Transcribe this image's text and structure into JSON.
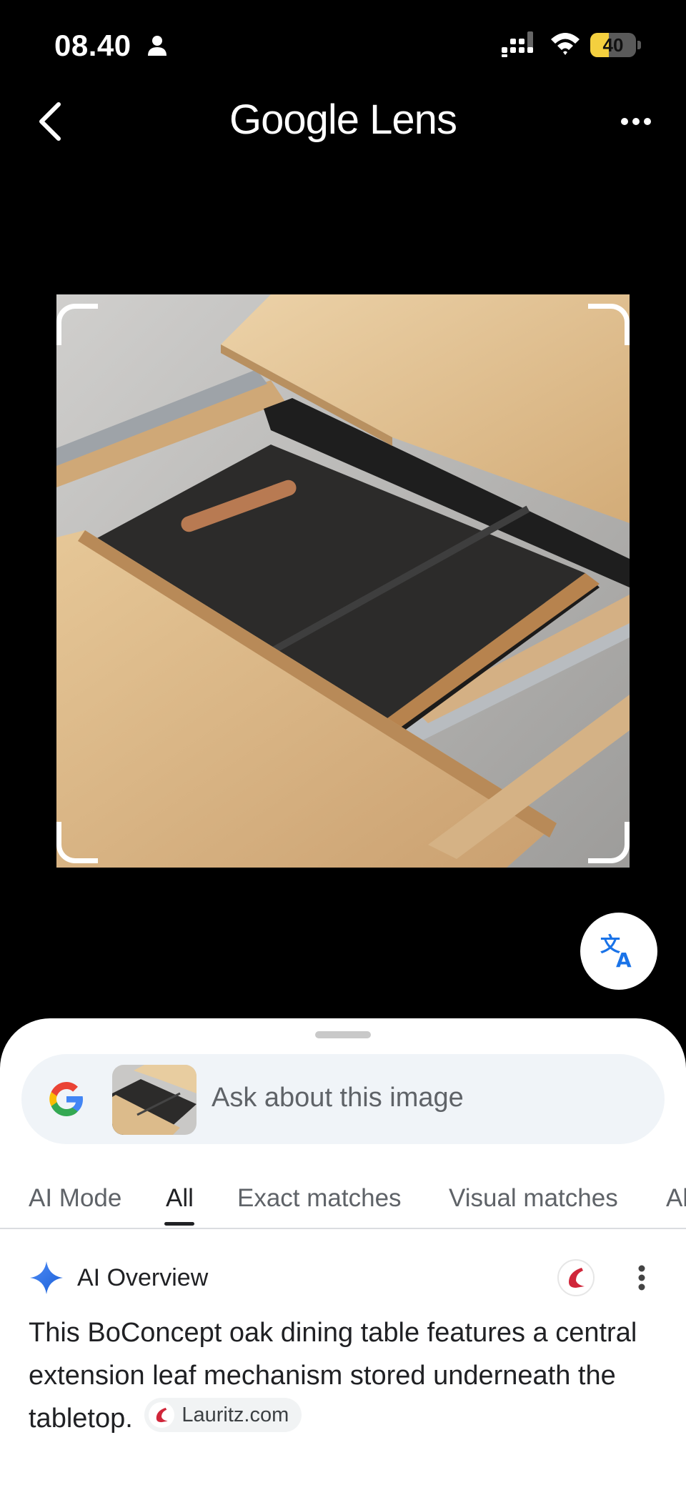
{
  "status_bar": {
    "time": "08.40",
    "battery_level": "40",
    "battery_fraction": 0.4
  },
  "header": {
    "title": "Google Lens",
    "icons": [
      "back-arrow-icon",
      "more-horizontal-icon"
    ]
  },
  "image": {
    "description_icon": "extendable-table-photo",
    "translate_icon": "translate-icon"
  },
  "search": {
    "placeholder": "Ask about this image"
  },
  "tabs": [
    {
      "label": "AI Mode",
      "active": false
    },
    {
      "label": "All",
      "active": true
    },
    {
      "label": "Exact matches",
      "active": false
    },
    {
      "label": "Visual matches",
      "active": false
    },
    {
      "label": "Al",
      "active": false
    }
  ],
  "ai_overview": {
    "title": "AI Overview",
    "text": "This BoConcept oak dining table features a central extension leaf mechanism stored underneath the tabletop.",
    "source_chip": "Lauritz.com"
  },
  "colors": {
    "accent_blue": "#1a73e8",
    "lauritz_red": "#d0263a",
    "battery_yellow": "#f4d03f",
    "sheet_bg": "#ffffff",
    "search_bg": "#f0f4f8"
  }
}
